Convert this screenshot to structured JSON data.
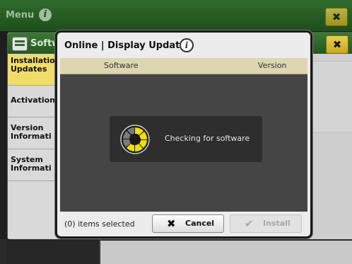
{
  "topbar": {
    "title": "Menu",
    "info_icon": "info-icon",
    "close_icon": "close-icon"
  },
  "background_window": {
    "title": "Softw",
    "app_icon": "display-settings-icon",
    "sidebar": [
      {
        "lines": [
          "Installatio",
          "Updates"
        ],
        "active": true
      },
      {
        "lines": [
          "Activation"
        ],
        "active": false
      },
      {
        "lines": [
          "Version",
          "Informati"
        ],
        "active": false
      },
      {
        "lines": [
          "System",
          "Informati"
        ],
        "active": false
      }
    ]
  },
  "dialog": {
    "title": "Online | Display Updates",
    "info_icon_glyph": "i",
    "columns": {
      "software": "Software",
      "version": "Version"
    },
    "progress": {
      "message": "Checking for software",
      "icon": "loading-spinner-icon"
    },
    "footer": {
      "items_selected": "(0) items selected",
      "cancel_label": "Cancel",
      "install_label": "Install"
    }
  },
  "colors": {
    "menu_green": "#2f6b2b",
    "highlight_yellow": "#f0dc68",
    "close_yellow": "#d9bd2c",
    "spinner_yellow": "#f2e000"
  }
}
